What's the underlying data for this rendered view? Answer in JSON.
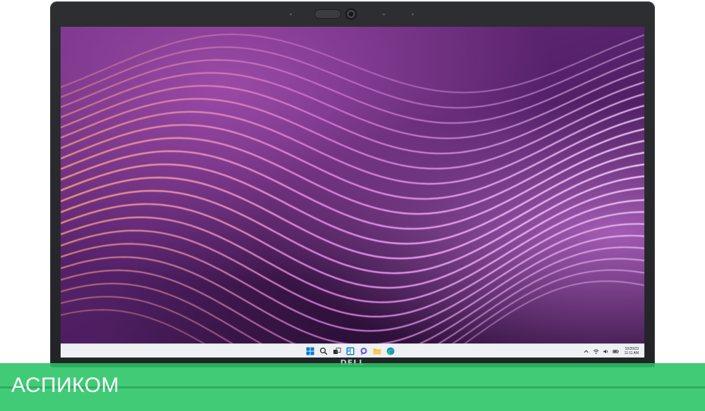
{
  "device": {
    "logo_text": "DELL"
  },
  "taskbar": {
    "icons": [
      "windows-start-icon",
      "search-icon",
      "task-view-icon",
      "widgets-icon",
      "chat-icon",
      "file-explorer-icon",
      "edge-browser-icon"
    ],
    "tray_icons": [
      "chevron-up-icon",
      "wifi-icon",
      "volume-icon",
      "battery-icon"
    ],
    "clock": {
      "date": "10/20/23",
      "time": "11:11 AM"
    }
  },
  "colors": {
    "taskbar_bg": "#eef0f4",
    "banner_green": "#28c464",
    "wave_pink": "#f08cf0",
    "wave_orange": "#f4a07a",
    "accent_blue": "#0078d4"
  },
  "banner": {
    "text": "АСПИКОМ"
  }
}
